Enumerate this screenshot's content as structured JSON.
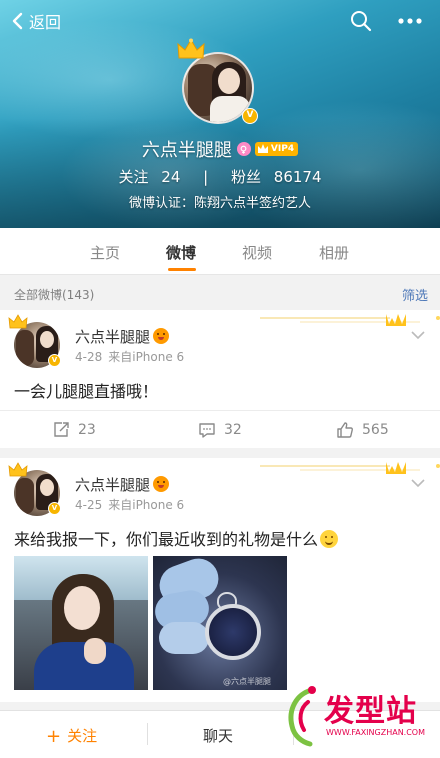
{
  "topbar": {
    "back_label": "返回"
  },
  "profile": {
    "name": "六点半腿腿",
    "vip_label": "VIP4",
    "following_label": "关注",
    "following_count": "24",
    "divider": "|",
    "followers_label": "粉丝",
    "followers_count": "86174",
    "verification": "微博认证：陈翔六点半签约艺人"
  },
  "tabs": [
    {
      "label": "主页",
      "active": false
    },
    {
      "label": "微博",
      "active": true
    },
    {
      "label": "视频",
      "active": false
    },
    {
      "label": "相册",
      "active": false
    }
  ],
  "filter": {
    "all_posts": "全部微博(143)",
    "filter_label": "筛选"
  },
  "posts": [
    {
      "author": "六点半腿腿",
      "date": "4-28",
      "source": "来自iPhone 6",
      "text": "一会儿腿腿直播哦！",
      "reposts": "23",
      "comments": "32",
      "likes": "565"
    },
    {
      "author": "六点半腿腿",
      "date": "4-25",
      "source": "来自iPhone 6",
      "text": "来给我报一下，你们最近收到的礼物是什么",
      "photo_watermark": "@六点半腿腿"
    }
  ],
  "bottombar": {
    "follow_label": "关注",
    "chat_label": "聊天"
  },
  "watermark": {
    "text": "发型站",
    "url": "WWW.FAXINGZHAN.COM"
  },
  "colors": {
    "accent": "#ff8200",
    "link": "#4d78b8",
    "vip": "#ffb400",
    "watermark": "#e4004b"
  },
  "icons": {
    "back": "chevron-left-icon",
    "search": "search-icon",
    "more": "more-dots-icon",
    "repost": "share-icon",
    "comment": "comment-icon",
    "like": "thumbs-up-icon",
    "dropdown": "chevron-down-icon"
  }
}
